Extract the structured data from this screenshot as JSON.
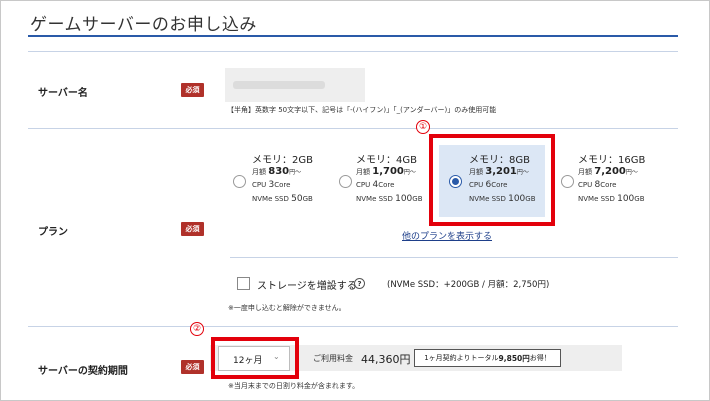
{
  "page": {
    "title": "ゲームサーバーのお申し込み"
  },
  "required_label": "必須",
  "server_name": {
    "label": "サーバー名",
    "hint": "【半角】英数字 50文字以下、記号は「-(ハイフン)」「_(アンダーバー)」のみ使用可能"
  },
  "plan": {
    "label": "プラン",
    "more_link": "他のプランを表示する",
    "cards": [
      {
        "memory": "メモリ：2GB",
        "price_prefix": "月額",
        "price": "830",
        "price_suffix": "円〜",
        "cpu_prefix": "CPU",
        "cpu": "3",
        "cpu_suffix": "Core",
        "ssd_prefix": "NVMe SSD",
        "ssd": "50",
        "ssd_suffix": "GB",
        "selected": false
      },
      {
        "memory": "メモリ：4GB",
        "price_prefix": "月額",
        "price": "1,700",
        "price_suffix": "円〜",
        "cpu_prefix": "CPU",
        "cpu": "4",
        "cpu_suffix": "Core",
        "ssd_prefix": "NVMe SSD",
        "ssd": "100",
        "ssd_suffix": "GB",
        "selected": false
      },
      {
        "memory": "メモリ：8GB",
        "price_prefix": "月額",
        "price": "3,201",
        "price_suffix": "円〜",
        "cpu_prefix": "CPU",
        "cpu": "6",
        "cpu_suffix": "Core",
        "ssd_prefix": "NVMe SSD",
        "ssd": "100",
        "ssd_suffix": "GB",
        "selected": true
      },
      {
        "memory": "メモリ：16GB",
        "price_prefix": "月額",
        "price": "7,200",
        "price_suffix": "円〜",
        "cpu_prefix": "CPU",
        "cpu": "8",
        "cpu_suffix": "Core",
        "ssd_prefix": "NVMe SSD",
        "ssd": "100",
        "ssd_suffix": "GB",
        "selected": false
      }
    ],
    "storage_option": {
      "label": "ストレージを増設する",
      "help_icon": "?",
      "note": "(NVMe SSD：+200GB / 月額：2,750円)",
      "checked": false
    },
    "storage_hint": "※一度申し込むと解除ができません。"
  },
  "contract": {
    "label": "サーバーの契約期間",
    "period_value": "12ヶ月",
    "fee_label": "ご利用料金",
    "fee_amount": "44,360円",
    "promo_prefix": "1ヶ月契約よりトータル",
    "promo_amount": "9,850円",
    "promo_suffix": "お得！",
    "hint": "※当月末までの日割り料金が含まれます。"
  },
  "annotations": {
    "marker1": "①",
    "marker2": "②",
    "color": "#e3000b"
  },
  "colors": {
    "accent": "#2a5aa8",
    "required_badge": "#b0312a",
    "selected_card": "#dce7f5"
  }
}
